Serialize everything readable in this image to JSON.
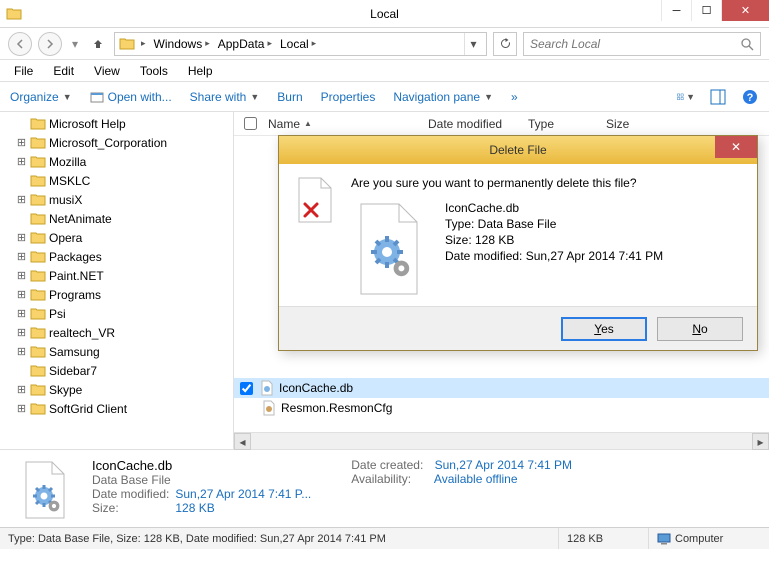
{
  "window": {
    "title": "Local"
  },
  "nav": {
    "path": [
      "Windows",
      "AppData",
      "Local"
    ],
    "search_placeholder": "Search Local"
  },
  "menu": [
    "File",
    "Edit",
    "View",
    "Tools",
    "Help"
  ],
  "toolbar": {
    "organize": "Organize",
    "open_with": "Open with...",
    "share_with": "Share with",
    "burn": "Burn",
    "properties": "Properties",
    "nav_pane": "Navigation pane",
    "overflow": "»"
  },
  "tree": [
    {
      "label": "Microsoft Help",
      "exp": ""
    },
    {
      "label": "Microsoft_Corporation",
      "exp": "+"
    },
    {
      "label": "Mozilla",
      "exp": "+"
    },
    {
      "label": "MSKLC",
      "exp": ""
    },
    {
      "label": "musiX",
      "exp": "+"
    },
    {
      "label": "NetAnimate",
      "exp": ""
    },
    {
      "label": "Opera",
      "exp": "+"
    },
    {
      "label": "Packages",
      "exp": "+"
    },
    {
      "label": "Paint.NET",
      "exp": "+"
    },
    {
      "label": "Programs",
      "exp": "+"
    },
    {
      "label": "Psi",
      "exp": "+"
    },
    {
      "label": "realtech_VR",
      "exp": "+"
    },
    {
      "label": "Samsung",
      "exp": "+"
    },
    {
      "label": "Sidebar7",
      "exp": ""
    },
    {
      "label": "Skype",
      "exp": "+"
    },
    {
      "label": "SoftGrid Client",
      "exp": "+"
    }
  ],
  "columns": {
    "name": "Name",
    "modified": "Date modified",
    "type": "Type",
    "size": "Size"
  },
  "files": [
    {
      "name": "IconCache.db",
      "selected": true
    },
    {
      "name": "Resmon.ResmonCfg",
      "selected": false
    }
  ],
  "details": {
    "name": "IconCache.db",
    "type": "Data Base File",
    "date_modified_label": "Date modified:",
    "date_modified": "Sun,27 Apr 2014 7:41 P...",
    "size_label": "Size:",
    "size": "128 KB",
    "date_created_label": "Date created:",
    "date_created": "Sun,27 Apr 2014 7:41 PM",
    "availability_label": "Availability:",
    "availability": "Available offline"
  },
  "status": {
    "main": "Type: Data Base File, Size: 128 KB, Date modified: Sun,27 Apr 2014 7:41 PM",
    "size": "128 KB",
    "location": "Computer"
  },
  "dialog": {
    "title": "Delete File",
    "message": "Are you sure you want to permanently delete this file?",
    "file_name": "IconCache.db",
    "file_type": "Type: Data Base File",
    "file_size": "Size: 128 KB",
    "file_modified": "Date modified: Sun,27 Apr 2014 7:41 PM",
    "yes": "Yes",
    "no": "No"
  }
}
